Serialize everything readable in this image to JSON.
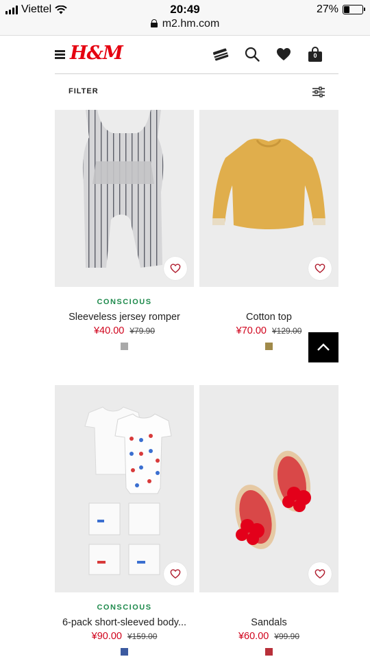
{
  "status": {
    "carrier": "Viettel",
    "time": "20:49",
    "battery": "27%",
    "battery_level": 0.27,
    "url": "m2.hm.com"
  },
  "header": {
    "logo": "H&M",
    "bag_count": "0",
    "icons": [
      "menu-icon",
      "card-icon",
      "search-icon",
      "heart-icon",
      "bag-icon"
    ]
  },
  "filter": {
    "label": "FILTER"
  },
  "products": [
    {
      "tag": "CONSCIOUS",
      "name": "Sleeveless jersey romper",
      "price": "¥40.00",
      "old_price": "¥79.90",
      "swatch": "#a9a9a9"
    },
    {
      "tag": "",
      "name": "Cotton top",
      "price": "¥70.00",
      "old_price": "¥129.00",
      "swatch": "#a08a4a"
    },
    {
      "tag": "CONSCIOUS",
      "name": "6-pack short-sleeved body...",
      "price": "¥90.00",
      "old_price": "¥159.00",
      "swatch": "#3c5aa0"
    },
    {
      "tag": "",
      "name": "Sandals",
      "price": "¥60.00",
      "old_price": "¥99.90",
      "swatch": "#b8303a"
    }
  ],
  "colors": {
    "brand": "#e50010",
    "sale": "#d0021b",
    "conscious": "#1e8a4c"
  }
}
